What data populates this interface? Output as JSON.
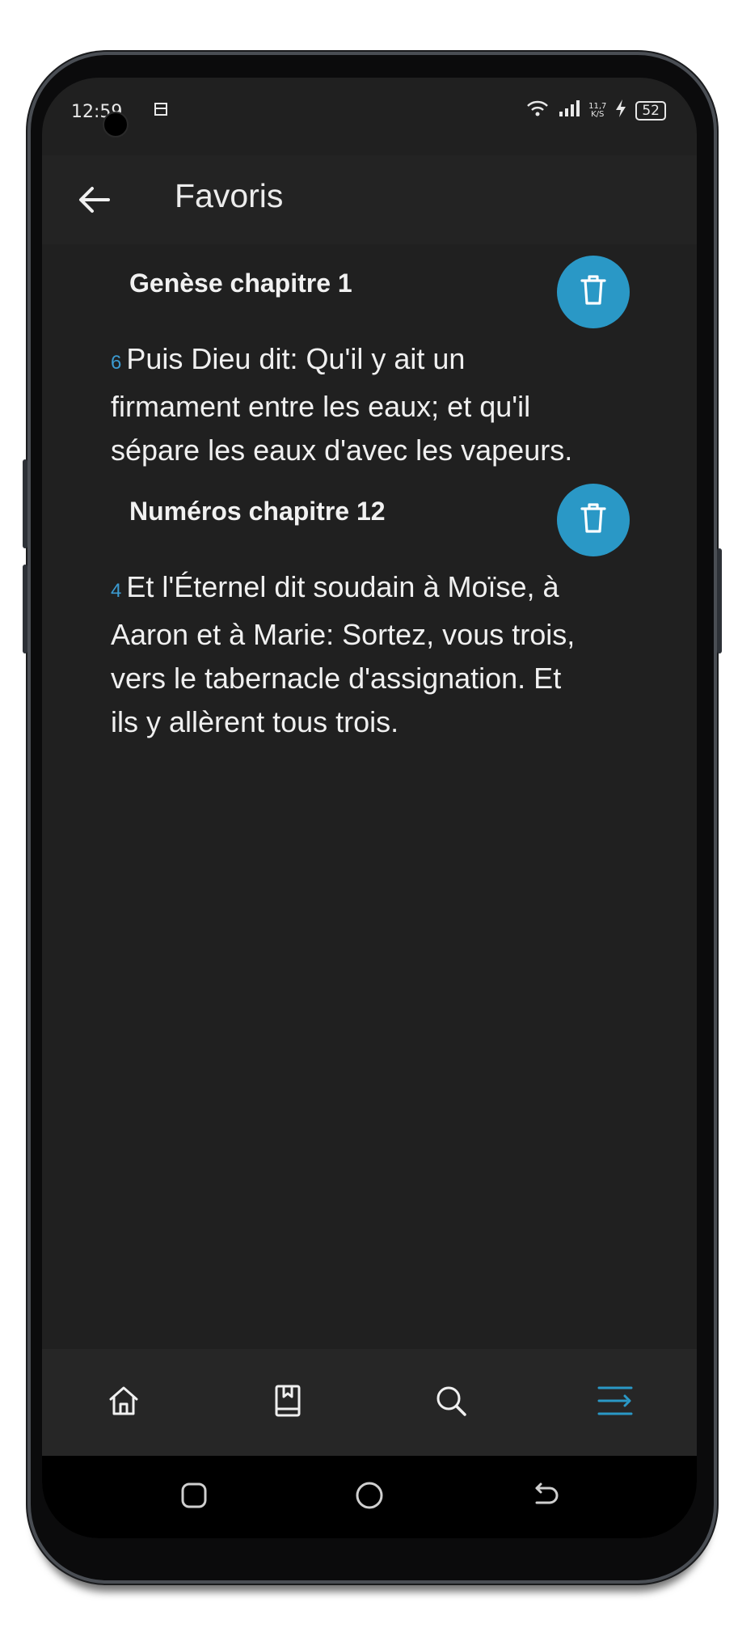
{
  "status": {
    "time": "12:59",
    "speed_top": "11,7",
    "speed_bottom": "K/S",
    "battery": "52"
  },
  "appbar": {
    "title": "Favoris",
    "back_icon": "arrow-left-icon"
  },
  "favorites": [
    {
      "chapter": "Genèse chapitre 1",
      "verse_number": "6",
      "verse_text": "Puis Dieu dit: Qu'il y ait un firmament entre les eaux; et qu'il sépare les eaux d'avec les vapeurs.",
      "delete_icon": "trash-icon"
    },
    {
      "chapter": "Numéros chapitre 12",
      "verse_number": "4",
      "verse_text": "Et l'Éternel dit soudain à Moïse, à Aaron et à Marie: Sortez, vous trois, vers le tabernacle d'assignation. Et ils y allèrent tous trois.",
      "delete_icon": "trash-icon"
    }
  ],
  "bottom_nav": [
    "home-icon",
    "book-bookmark-icon",
    "search-icon",
    "menu-list-icon"
  ],
  "colors": {
    "accent": "#2a98c6",
    "background": "#202020",
    "text": "#f0f0f0"
  }
}
